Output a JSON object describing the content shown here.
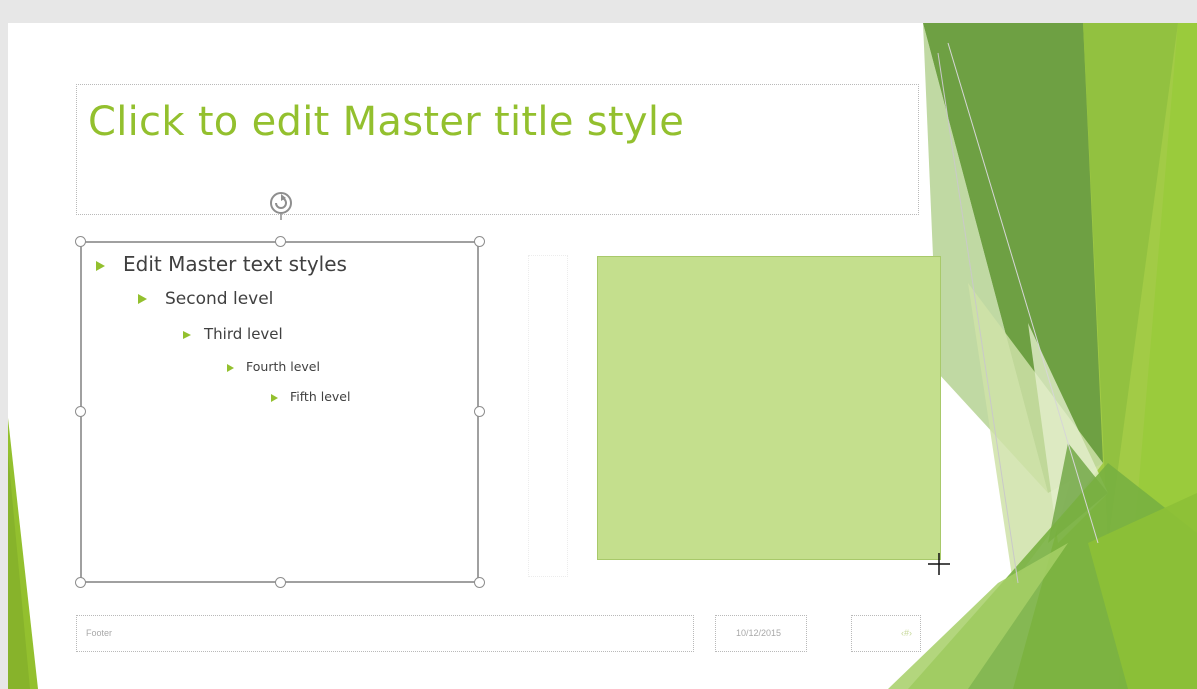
{
  "slide": {
    "title": "Click to edit Master title style",
    "bullets": [
      "Edit Master text styles",
      "Second level",
      "Third level",
      "Fourth level",
      "Fifth level"
    ],
    "footer": "Footer",
    "date": "10/12/2015",
    "slide_number": "‹#›"
  },
  "colors": {
    "accent": "#93c02e",
    "picture_fill": "#c4df8d",
    "text": "#404040"
  },
  "icons": [
    "rotate-handle-icon",
    "crosshair-cursor-icon",
    "bullet-arrow-icon"
  ]
}
